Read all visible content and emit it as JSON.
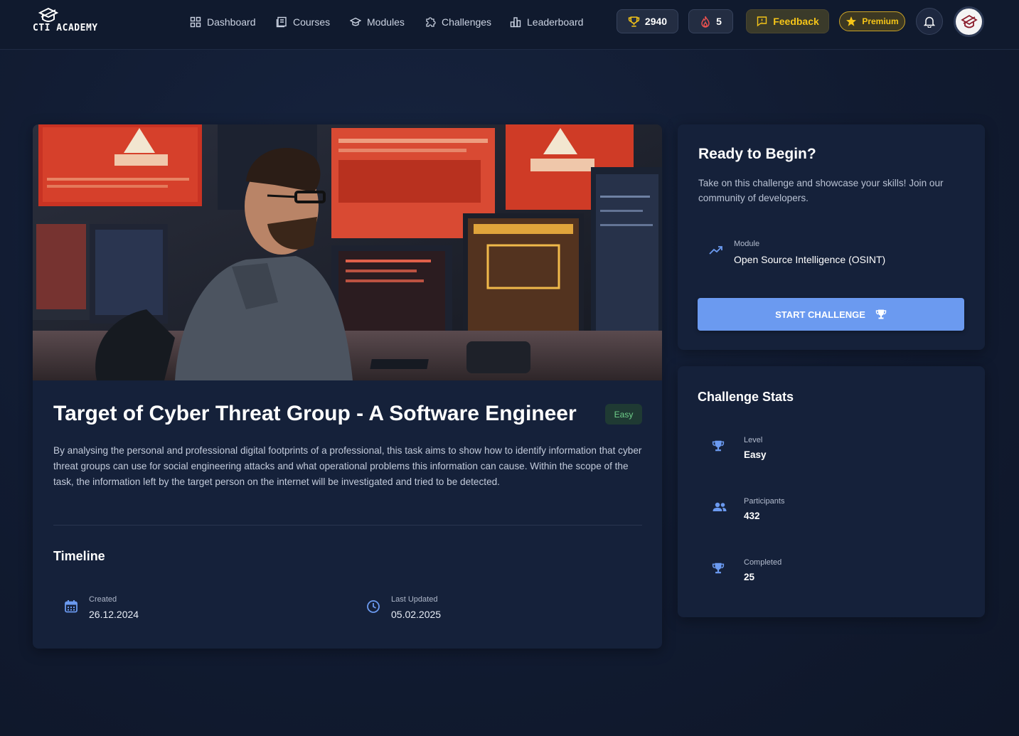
{
  "brand": {
    "logo_text": "CTI ACADEMY"
  },
  "nav": {
    "items": [
      {
        "label": "Dashboard",
        "icon": "grid-icon"
      },
      {
        "label": "Courses",
        "icon": "book-icon"
      },
      {
        "label": "Modules",
        "icon": "graduation-cap-icon"
      },
      {
        "label": "Challenges",
        "icon": "puzzle-icon"
      },
      {
        "label": "Leaderboard",
        "icon": "bar-chart-icon"
      }
    ]
  },
  "header": {
    "points": "2940",
    "streak": "5",
    "feedback_label": "Feedback",
    "premium_label": "Premium"
  },
  "challenge": {
    "title": "Target of Cyber Threat Group - A Software Engineer",
    "difficulty_badge": "Easy",
    "description": "By analysing the personal and professional digital footprints of a professional, this task aims to show how to identify information that cyber threat groups can use for social engineering attacks and what operational problems this information can cause. Within the scope of the task, the information left by the target person on the internet will be investigated and tried to be detected.",
    "timeline": {
      "title": "Timeline",
      "created_label": "Created",
      "created_value": "26.12.2024",
      "updated_label": "Last Updated",
      "updated_value": "05.02.2025"
    }
  },
  "ready": {
    "title": "Ready to Begin?",
    "description": "Take on this challenge and showcase your skills! Join our community of developers.",
    "module_label": "Module",
    "module_value": "Open Source Intelligence (OSINT)",
    "start_button": "START CHALLENGE"
  },
  "stats": {
    "title": "Challenge Stats",
    "items": [
      {
        "label": "Level",
        "value": "Easy",
        "icon": "trophy-icon"
      },
      {
        "label": "Participants",
        "value": "432",
        "icon": "users-icon"
      },
      {
        "label": "Completed",
        "value": "25",
        "icon": "trophy-icon"
      }
    ]
  },
  "colors": {
    "accent": "#6b9af0",
    "premium": "#f5c518",
    "easy": "#6fcf8a",
    "streak": "#f0524f"
  }
}
